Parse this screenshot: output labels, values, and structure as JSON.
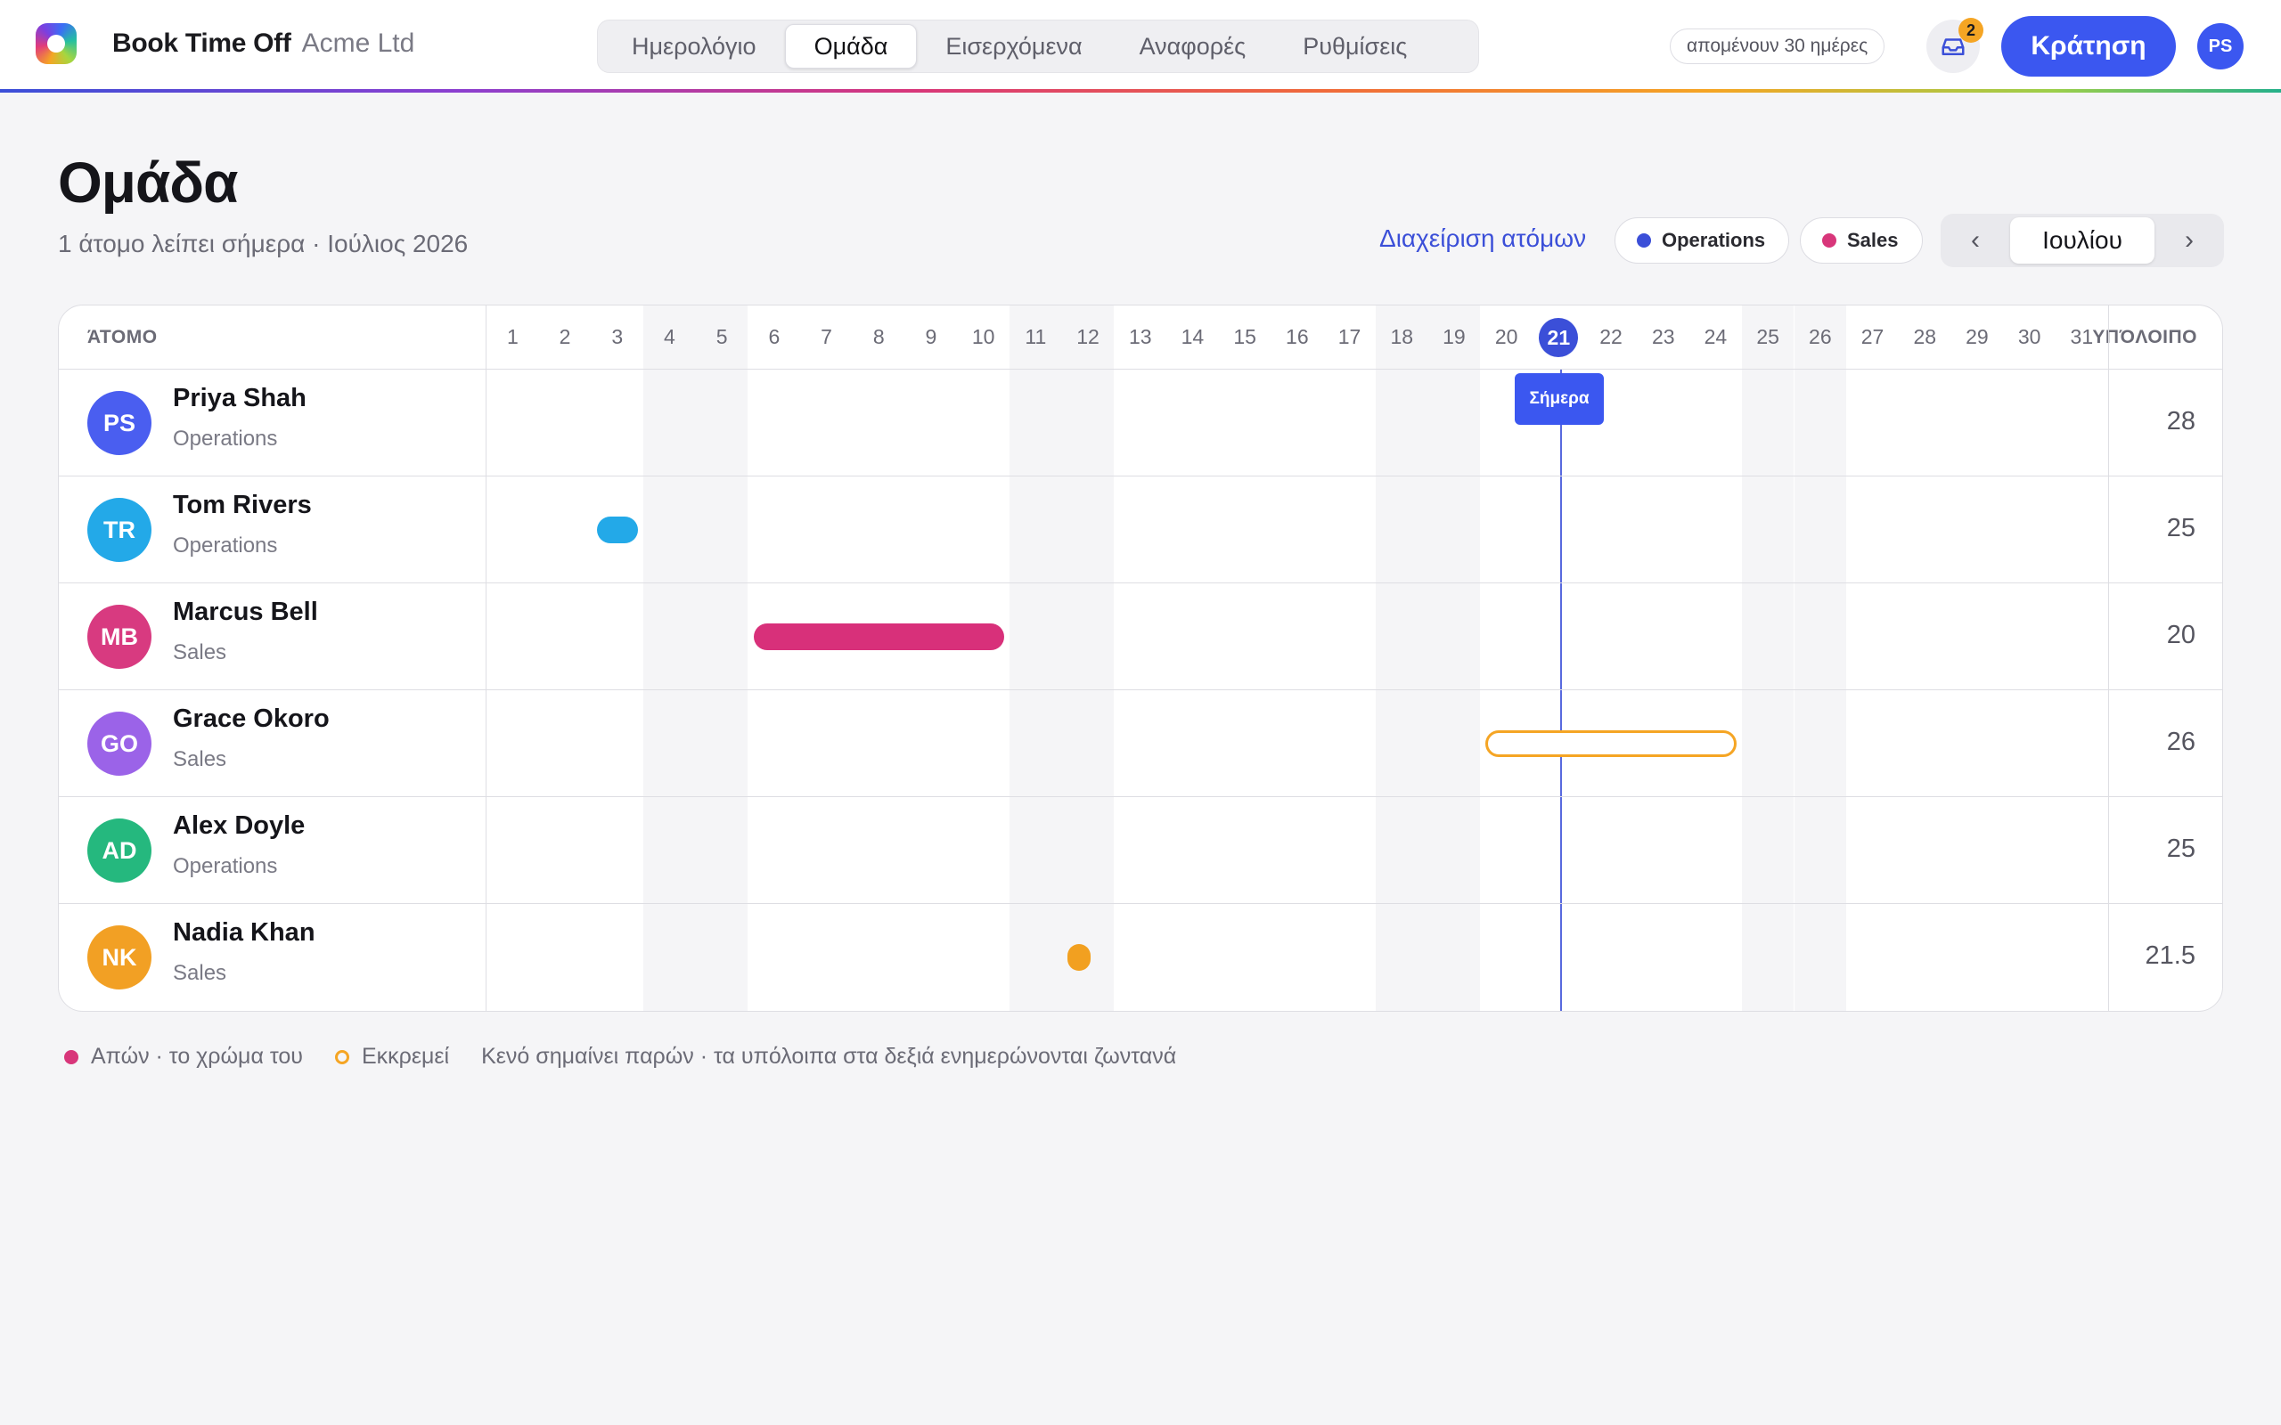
{
  "header": {
    "brand_name": "Book Time Off",
    "company": "Acme Ltd",
    "tabs": [
      {
        "label": "Ημερολόγιο"
      },
      {
        "label": "Ομάδα"
      },
      {
        "label": "Εισερχόμενα"
      },
      {
        "label": "Αναφορές"
      },
      {
        "label": "Ρυθμίσεις"
      }
    ],
    "active_tab": "Ομάδα",
    "days_left": "απομένουν 30 ημέρες",
    "inbox_count": "2",
    "book_label": "Κράτηση",
    "user_initials": "PS"
  },
  "page": {
    "title": "Ομάδα",
    "subtitle": "1 άτομο λείπει σήμερα · Ιούλιος 2026",
    "manage_link": "Διαχείριση ατόμων",
    "departments": [
      {
        "label": "Operations",
        "color": "#3b4fd8"
      },
      {
        "label": "Sales",
        "color": "#d8367a"
      }
    ],
    "month_label": "Ιουλίου",
    "prev_icon": "‹",
    "next_icon": "›"
  },
  "grid": {
    "person_header": "ΆΤΟΜΟ",
    "remaining_header": "ΥΠΌΛΟΙΠΟ",
    "days": [
      1,
      2,
      3,
      4,
      5,
      6,
      7,
      8,
      9,
      10,
      11,
      12,
      13,
      14,
      15,
      16,
      17,
      18,
      19,
      20,
      21,
      22,
      23,
      24,
      25,
      26,
      27,
      28,
      29,
      30,
      31
    ],
    "weekend_days": [
      4,
      5,
      11,
      12,
      18,
      19,
      25,
      26
    ],
    "today": 21,
    "today_label": "Σήμερα",
    "people": [
      {
        "initials": "PS",
        "name": "Priya Shah",
        "dept": "Operations",
        "remaining": "28",
        "avatar_color": "#4a5ef0",
        "absences": []
      },
      {
        "initials": "TR",
        "name": "Tom Rivers",
        "dept": "Operations",
        "remaining": "25",
        "avatar_color": "#23a9e8",
        "absences": [
          {
            "start": 3,
            "end": 3,
            "color": "#23a9e8",
            "status": "approved"
          }
        ]
      },
      {
        "initials": "MB",
        "name": "Marcus Bell",
        "dept": "Sales",
        "remaining": "20",
        "avatar_color": "#d83a80",
        "absences": [
          {
            "start": 6,
            "end": 10,
            "color": "#d8307a",
            "status": "approved"
          }
        ]
      },
      {
        "initials": "GO",
        "name": "Grace Okoro",
        "dept": "Sales",
        "remaining": "26",
        "avatar_color": "#9b63e8",
        "absences": [
          {
            "start": 20,
            "end": 24,
            "color": "#f5a524",
            "status": "pending"
          }
        ]
      },
      {
        "initials": "AD",
        "name": "Alex Doyle",
        "dept": "Operations",
        "remaining": "25",
        "avatar_color": "#25b87e",
        "absences": []
      },
      {
        "initials": "NK",
        "name": "Nadia Khan",
        "dept": "Sales",
        "remaining": "21.5",
        "avatar_color": "#f2a024",
        "absences": [
          {
            "start": 12,
            "end": 12,
            "half": true,
            "color": "#f2a020",
            "status": "approved"
          }
        ]
      }
    ]
  },
  "legend": {
    "away": "Απών · το χρώμα του",
    "pending": "Εκκρεμεί",
    "note": "Κενό σημαίνει παρών · τα υπόλοιπα στα δεξιά ενημερώνονται ζωντανά"
  }
}
